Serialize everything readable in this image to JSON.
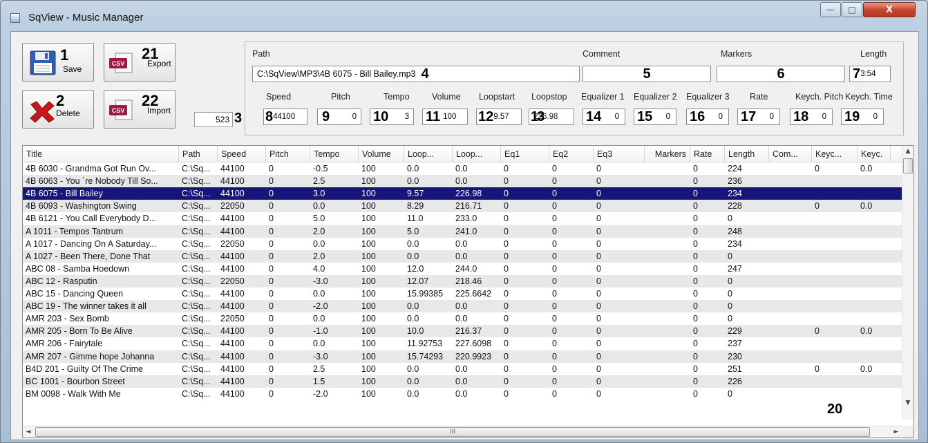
{
  "window": {
    "title": "SqView - Music Manager",
    "min_glyph": "—",
    "max_glyph": "□",
    "close_glyph": "X"
  },
  "toolbar": {
    "save": {
      "num": "1",
      "label": "Save"
    },
    "export": {
      "num": "21",
      "label": "Export",
      "icon_text": "CSV"
    },
    "delete": {
      "num": "2",
      "label": "Delete"
    },
    "import": {
      "num": "22",
      "label": "Import",
      "icon_text": "CSV"
    },
    "count": {
      "value": "523",
      "num": "3"
    }
  },
  "details": {
    "path": {
      "label": "Path",
      "value": "C:\\SqView\\MP3\\4B 6075 - Bill Bailey.mp3",
      "num": "4"
    },
    "comment": {
      "label": "Comment",
      "value": "",
      "num": "5"
    },
    "markers": {
      "label": "Markers",
      "value": "",
      "num": "6"
    },
    "length": {
      "label": "Length",
      "value": "3:54",
      "num": "7"
    },
    "speed": {
      "label": "Speed",
      "value": "44100",
      "num": "8"
    },
    "pitch": {
      "label": "Pitch",
      "value": "0",
      "num": "9"
    },
    "tempo": {
      "label": "Tempo",
      "value": "3",
      "num": "10"
    },
    "volume": {
      "label": "Volume",
      "value": "100",
      "num": "11"
    },
    "loopstart": {
      "label": "Loopstart",
      "value": "9.57",
      "num": "12"
    },
    "loopstop": {
      "label": "Loopstop",
      "value": "226.98",
      "num": "13"
    },
    "eq1": {
      "label": "Equalizer 1",
      "value": "0",
      "num": "14"
    },
    "eq2": {
      "label": "Equalizer 2",
      "value": "0",
      "num": "15"
    },
    "eq3": {
      "label": "Equalizer 3",
      "value": "0",
      "num": "16"
    },
    "rate": {
      "label": "Rate",
      "value": "0",
      "num": "17"
    },
    "kpitch": {
      "label": "Keych. Pitch",
      "value": "0",
      "num": "18"
    },
    "ktime": {
      "label": "Keych. Time",
      "value": "0",
      "num": "19"
    }
  },
  "list": {
    "annotation": "20",
    "columns": [
      "Title",
      "Path",
      "Speed",
      "Pitch",
      "Tempo",
      "Volume",
      "Loop...",
      "Loop...",
      "Eq1",
      "Eq2",
      "Eq3",
      "Markers",
      "Rate",
      "Length",
      "Com...",
      "Keyc...",
      "Keyc."
    ],
    "rows": [
      [
        "4B 6030 - Grandma Got Run Ov...",
        "C:\\Sq...",
        "44100",
        "0",
        "-0.5",
        "100",
        "0.0",
        "0.0",
        "0",
        "0",
        "0",
        "",
        "0",
        "224",
        "",
        "0",
        "0.0"
      ],
      [
        "4B 6063 - You ´re Nobody Till So...",
        "C:\\Sq...",
        "44100",
        "0",
        "2.5",
        "100",
        "0.0",
        "0.0",
        "0",
        "0",
        "0",
        "",
        "0",
        "236",
        "",
        "",
        ""
      ],
      [
        "4B 6075 - Bill Bailey",
        "C:\\Sq...",
        "44100",
        "0",
        "3.0",
        "100",
        "9.57",
        "226.98",
        "0",
        "0",
        "0",
        "",
        "0",
        "234",
        "",
        "",
        ""
      ],
      [
        "4B 6093 - Washington Swing",
        "C:\\Sq...",
        "22050",
        "0",
        "0.0",
        "100",
        "8.29",
        "216.71",
        "0",
        "0",
        "0",
        "",
        "0",
        "228",
        "",
        "0",
        "0.0"
      ],
      [
        "4B 6121 - You Call Everybody D...",
        "C:\\Sq...",
        "44100",
        "0",
        "5.0",
        "100",
        "11.0",
        "233.0",
        "0",
        "0",
        "0",
        "",
        "0",
        "0",
        "",
        "",
        ""
      ],
      [
        "A 1011 - Tempos Tantrum",
        "C:\\Sq...",
        "44100",
        "0",
        "2.0",
        "100",
        "5.0",
        "241.0",
        "0",
        "0",
        "0",
        "",
        "0",
        "248",
        "",
        "",
        ""
      ],
      [
        "A 1017 - Dancing On A Saturday...",
        "C:\\Sq...",
        "22050",
        "0",
        "0.0",
        "100",
        "0.0",
        "0.0",
        "0",
        "0",
        "0",
        "",
        "0",
        "234",
        "",
        "",
        ""
      ],
      [
        "A 1027 - Been There, Done That",
        "C:\\Sq...",
        "44100",
        "0",
        "2.0",
        "100",
        "0.0",
        "0.0",
        "0",
        "0",
        "0",
        "",
        "0",
        "0",
        "",
        "",
        ""
      ],
      [
        "ABC 08 - Samba Hoedown",
        "C:\\Sq...",
        "44100",
        "0",
        "4.0",
        "100",
        "12.0",
        "244.0",
        "0",
        "0",
        "0",
        "",
        "0",
        "247",
        "",
        "",
        ""
      ],
      [
        "ABC 12 - Rasputin",
        "C:\\Sq...",
        "22050",
        "0",
        "-3.0",
        "100",
        "12.07",
        "218.46",
        "0",
        "0",
        "0",
        "",
        "0",
        "0",
        "",
        "",
        ""
      ],
      [
        "ABC 15 - Dancing Queen",
        "C:\\Sq...",
        "44100",
        "0",
        "0.0",
        "100",
        "15.99385",
        "225.6642",
        "0",
        "0",
        "0",
        "",
        "0",
        "0",
        "",
        "",
        ""
      ],
      [
        "ABC 19 - The winner takes it all",
        "C:\\Sq...",
        "44100",
        "0",
        "-2.0",
        "100",
        "0.0",
        "0.0",
        "0",
        "0",
        "0",
        "",
        "0",
        "0",
        "",
        "",
        ""
      ],
      [
        "AMR 203 - Sex Bomb",
        "C:\\Sq...",
        "22050",
        "0",
        "0.0",
        "100",
        "0.0",
        "0.0",
        "0",
        "0",
        "0",
        "",
        "0",
        "0",
        "",
        "",
        ""
      ],
      [
        "AMR 205 - Born To Be Alive",
        "C:\\Sq...",
        "44100",
        "0",
        "-1.0",
        "100",
        "10.0",
        "216.37",
        "0",
        "0",
        "0",
        "",
        "0",
        "229",
        "",
        "0",
        "0.0"
      ],
      [
        "AMR 206 - Fairytale",
        "C:\\Sq...",
        "44100",
        "0",
        "0.0",
        "100",
        "11.92753",
        "227.6098",
        "0",
        "0",
        "0",
        "",
        "0",
        "237",
        "",
        "",
        ""
      ],
      [
        "AMR 207 - Gimme hope Johanna",
        "C:\\Sq...",
        "44100",
        "0",
        "-3.0",
        "100",
        "15.74293",
        "220.9923",
        "0",
        "0",
        "0",
        "",
        "0",
        "230",
        "",
        "",
        ""
      ],
      [
        "B4D 201 - Guilty Of The Crime",
        "C:\\Sq...",
        "44100",
        "0",
        "2.5",
        "100",
        "0.0",
        "0.0",
        "0",
        "0",
        "0",
        "",
        "0",
        "251",
        "",
        "0",
        "0.0"
      ],
      [
        "BC 1001 - Bourbon Street",
        "C:\\Sq...",
        "44100",
        "0",
        "1.5",
        "100",
        "0.0",
        "0.0",
        "0",
        "0",
        "0",
        "",
        "0",
        "226",
        "",
        "",
        ""
      ],
      [
        "BM 0098 - Walk With Me",
        "C:\\Sq...",
        "44100",
        "0",
        "-2.0",
        "100",
        "0.0",
        "0.0",
        "0",
        "0",
        "0",
        "",
        "0",
        "0",
        "",
        "",
        ""
      ]
    ],
    "selected_index": 2
  },
  "scrollbar": {
    "h_thumb_glyph": "III",
    "up": "▲",
    "down": "▼",
    "left": "◄",
    "right": "►"
  }
}
